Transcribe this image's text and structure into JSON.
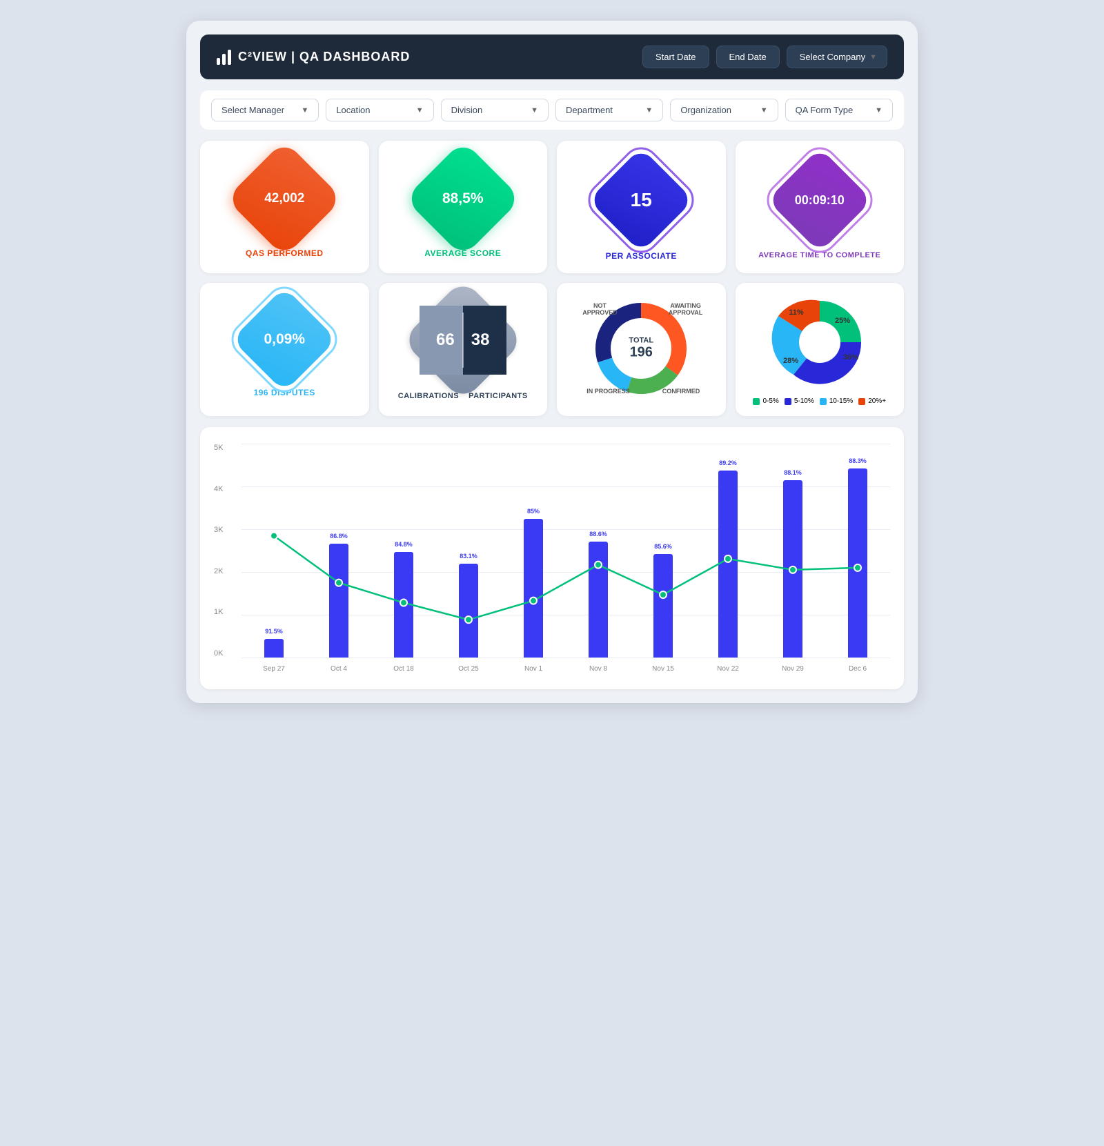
{
  "header": {
    "logo_text": "C²VIEW | QA DASHBOARD",
    "start_date_label": "Start Date",
    "end_date_label": "End Date",
    "select_company_label": "Select Company"
  },
  "filters": [
    {
      "label": "Select Manager",
      "id": "filter-manager"
    },
    {
      "label": "Location",
      "id": "filter-location"
    },
    {
      "label": "Division",
      "id": "filter-division"
    },
    {
      "label": "Department",
      "id": "filter-department"
    },
    {
      "label": "Organization",
      "id": "filter-organization"
    },
    {
      "label": "QA Form Type",
      "id": "filter-qaformtype"
    }
  ],
  "kpi_top": [
    {
      "value": "42,002",
      "label": "QAS PERFORMED",
      "color": "#e8440a",
      "border_color": "#f06030",
      "label_color": "#e8440a",
      "type": "solid"
    },
    {
      "value": "88,5%",
      "label": "AVERAGE SCORE",
      "color": "#00c07a",
      "border_color": "#00e090",
      "label_color": "#00c07a",
      "type": "solid"
    },
    {
      "value": "15",
      "label": "PER ASSOCIATE",
      "color": "#2828d8",
      "border_color": "#9060e8",
      "label_color": "#2828d8",
      "type": "border"
    },
    {
      "value": "00:09:10",
      "label": "AVERAGE TIME TO COMPLETE",
      "color": "#7c3ab8",
      "border_color": "#c080e8",
      "label_color": "#7c3ab8",
      "type": "border"
    }
  ],
  "kpi_disputes": {
    "value": "0,09%",
    "label": "196 DISPUTES",
    "color": "#29b6f6",
    "label_color": "#29b6f6"
  },
  "calibrations": {
    "left_value": "66",
    "right_value": "38",
    "left_label": "CALIBRATIONS",
    "right_label": "PARTICIPANTS"
  },
  "donut": {
    "total": "196",
    "total_label": "TOTAL",
    "segments": [
      {
        "label": "NOT APPROVED",
        "color": "#4caf50",
        "percent": 20
      },
      {
        "label": "AWAITING APPROVAL",
        "color": "#29b6f6",
        "percent": 15
      },
      {
        "label": "CONFIRMED",
        "color": "#1a237e",
        "percent": 30
      },
      {
        "label": "IN PROGRESS",
        "color": "#ff5722",
        "percent": 35
      }
    ]
  },
  "pie": {
    "segments": [
      {
        "label": "0-5%",
        "color": "#00c07a",
        "value": 28
      },
      {
        "label": "5-10%",
        "color": "#2828d8",
        "value": 36
      },
      {
        "label": "10-15%",
        "color": "#29b6f6",
        "value": 25
      },
      {
        "label": "20%+",
        "color": "#e8440a",
        "value": 11
      }
    ],
    "percent_labels": [
      "11%",
      "25%",
      "28%",
      "36%"
    ]
  },
  "chart": {
    "y_labels": [
      "5K",
      "4K",
      "3K",
      "2K",
      "1K",
      "0K"
    ],
    "bars": [
      {
        "x_label": "Sep 27",
        "height_pct": 9,
        "score": "91.5%"
      },
      {
        "x_label": "Oct 4",
        "height_pct": 56,
        "score": "86.8%"
      },
      {
        "x_label": "Oct 18",
        "height_pct": 52,
        "score": "84.8%"
      },
      {
        "x_label": "Oct 25",
        "height_pct": 46,
        "score": "83.1%"
      },
      {
        "x_label": "Nov 1",
        "height_pct": 68,
        "score": "85%"
      },
      {
        "x_label": "Nov 8",
        "height_pct": 57,
        "score": "88.6%"
      },
      {
        "x_label": "Nov 15",
        "height_pct": 51,
        "score": "85.6%"
      },
      {
        "x_label": "Nov 22",
        "height_pct": 92,
        "score": "89.2%"
      },
      {
        "x_label": "Nov 29",
        "height_pct": 87,
        "score": "88.1%"
      },
      {
        "x_label": "Dec 6",
        "height_pct": 93,
        "score": "88.3%"
      }
    ],
    "line_points": "47,28 148,88 249,92 351,96 452,76 553,87 654,91 755,30 856,36 957,27"
  }
}
